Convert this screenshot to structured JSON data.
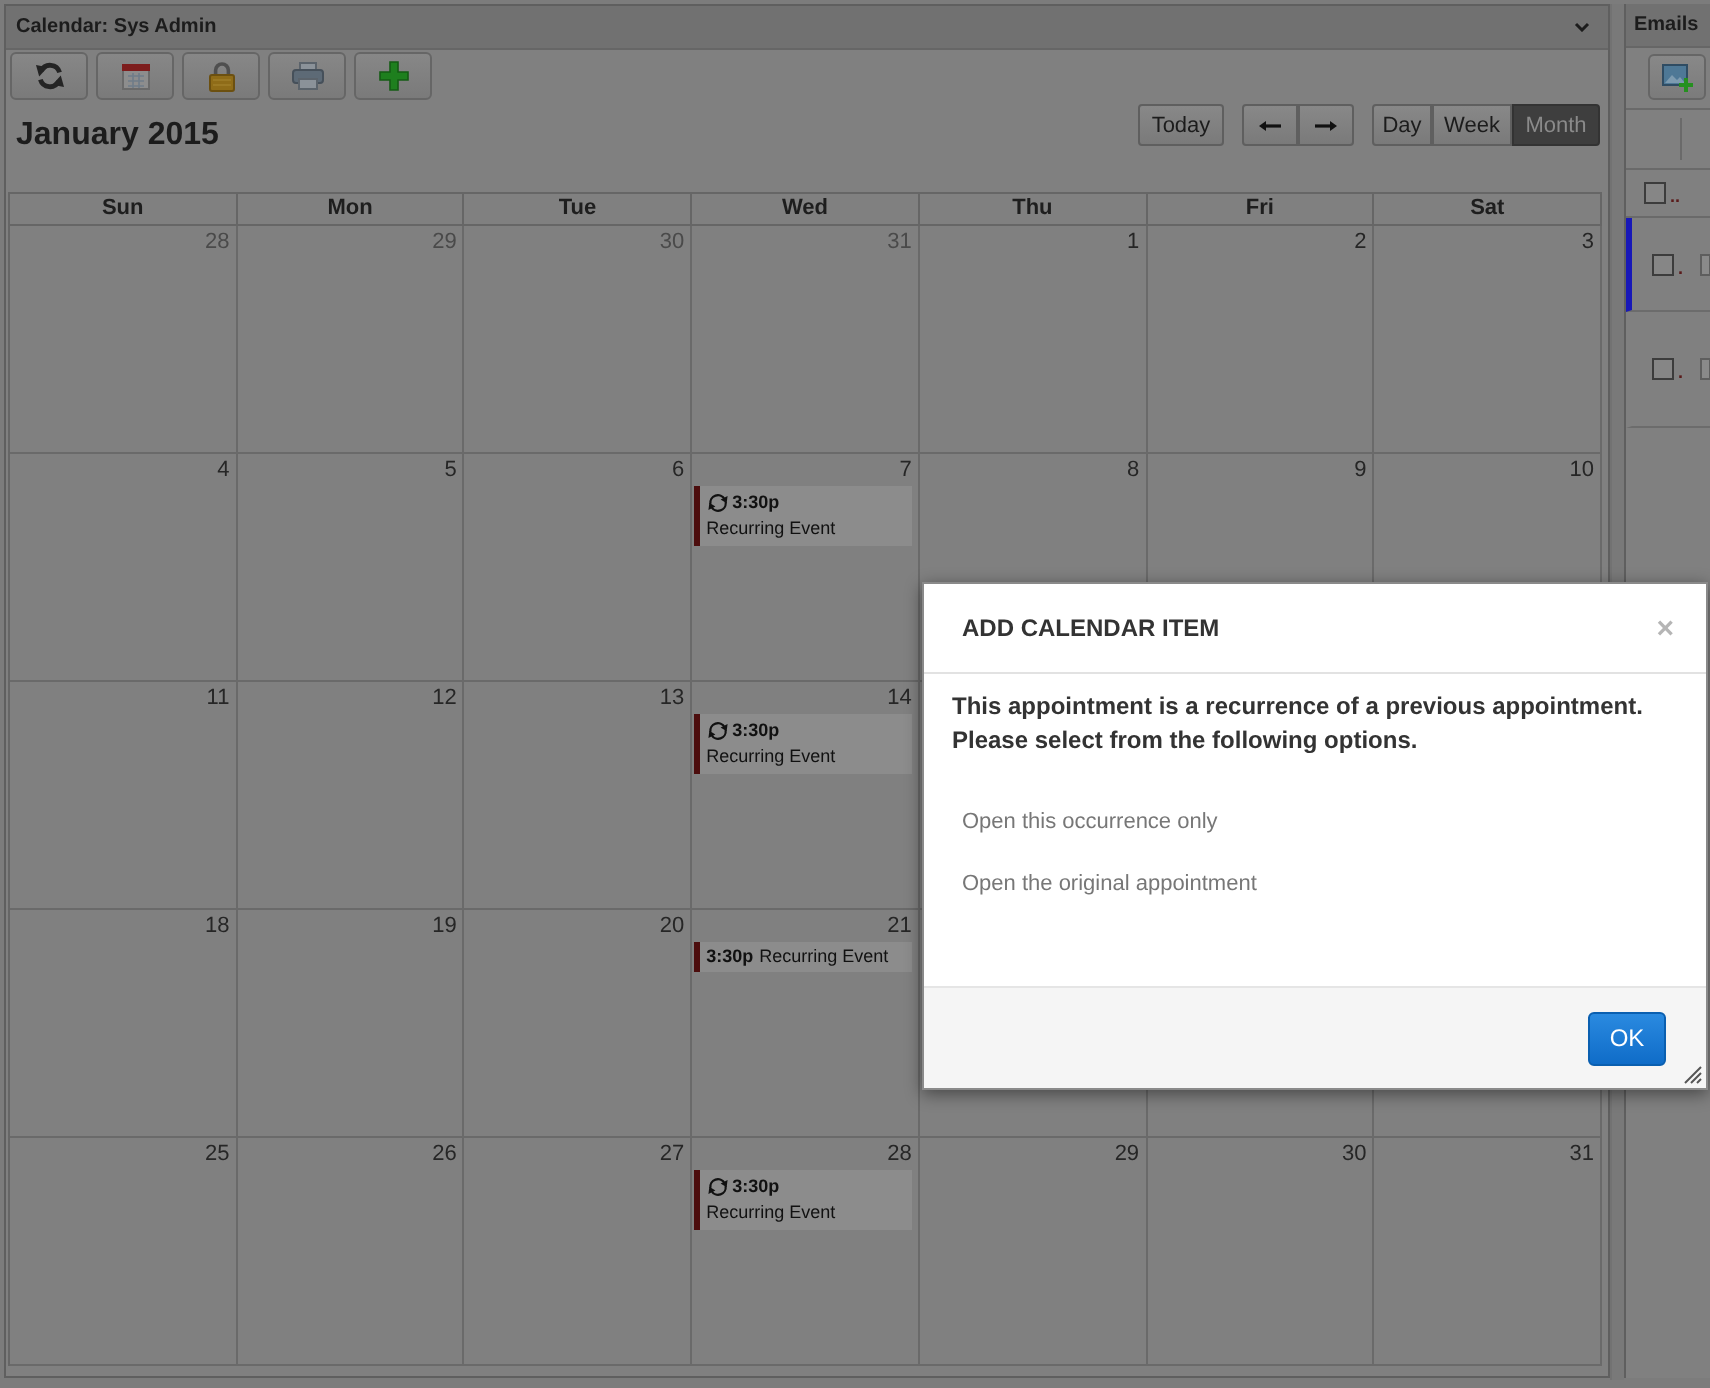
{
  "calendar_panel": {
    "title": "Calendar: Sys Admin",
    "month_title": "January 2015",
    "today_button": "Today",
    "views": [
      {
        "label": "Day",
        "selected": false
      },
      {
        "label": "Week",
        "selected": false
      },
      {
        "label": "Month",
        "selected": true
      }
    ],
    "weekdays": [
      "Sun",
      "Mon",
      "Tue",
      "Wed",
      "Thu",
      "Fri",
      "Sat"
    ],
    "weeks": [
      {
        "days": [
          {
            "day": "28",
            "other_month": true
          },
          {
            "day": "29",
            "other_month": true
          },
          {
            "day": "30",
            "other_month": true
          },
          {
            "day": "31",
            "other_month": true
          },
          {
            "day": "1",
            "other_month": false
          },
          {
            "day": "2",
            "other_month": false
          },
          {
            "day": "3",
            "other_month": false
          }
        ]
      },
      {
        "days": [
          {
            "day": "4",
            "other_month": false
          },
          {
            "day": "5",
            "other_month": false
          },
          {
            "day": "6",
            "other_month": false
          },
          {
            "day": "7",
            "other_month": false,
            "events": [
              {
                "time": "3:30p",
                "title": "Recurring Event",
                "recurring": true
              }
            ]
          },
          {
            "day": "8",
            "other_month": false
          },
          {
            "day": "9",
            "other_month": false
          },
          {
            "day": "10",
            "other_month": false
          }
        ]
      },
      {
        "days": [
          {
            "day": "11",
            "other_month": false
          },
          {
            "day": "12",
            "other_month": false
          },
          {
            "day": "13",
            "other_month": false
          },
          {
            "day": "14",
            "other_month": false,
            "events": [
              {
                "time": "3:30p",
                "title": "Recurring Event",
                "recurring": true
              }
            ]
          }
        ]
      },
      {
        "days": [
          {
            "day": "18",
            "other_month": false
          },
          {
            "day": "19",
            "other_month": false
          },
          {
            "day": "20",
            "other_month": false
          },
          {
            "day": "21",
            "other_month": false,
            "events": [
              {
                "time": "3:30p",
                "title": "Recurring Event",
                "recurring": false
              }
            ]
          }
        ]
      },
      {
        "days": [
          {
            "day": "25",
            "other_month": false
          },
          {
            "day": "26",
            "other_month": false
          },
          {
            "day": "27",
            "other_month": false
          },
          {
            "day": "28",
            "other_month": false,
            "events": [
              {
                "time": "3:30p",
                "title": "Recurring Event",
                "recurring": true
              }
            ]
          },
          {
            "day": "29",
            "other_month": false
          },
          {
            "day": "30",
            "other_month": false
          },
          {
            "day": "31",
            "other_month": false
          }
        ]
      }
    ]
  },
  "emails_panel": {
    "title": "Emails",
    "header_row": {
      "checked": false,
      "text": ".."
    },
    "rows": [
      {
        "checked": false,
        "selected": true,
        "text": "."
      },
      {
        "checked": false,
        "selected": false,
        "text": "."
      }
    ]
  },
  "dialog": {
    "title": "ADD CALENDAR ITEM",
    "close": "×",
    "message": "This appointment is a recurrence of a previous appointment. Please select from the following options.",
    "options": [
      "Open this occurrence only",
      "Open the original appointment"
    ],
    "ok_button": "OK"
  }
}
